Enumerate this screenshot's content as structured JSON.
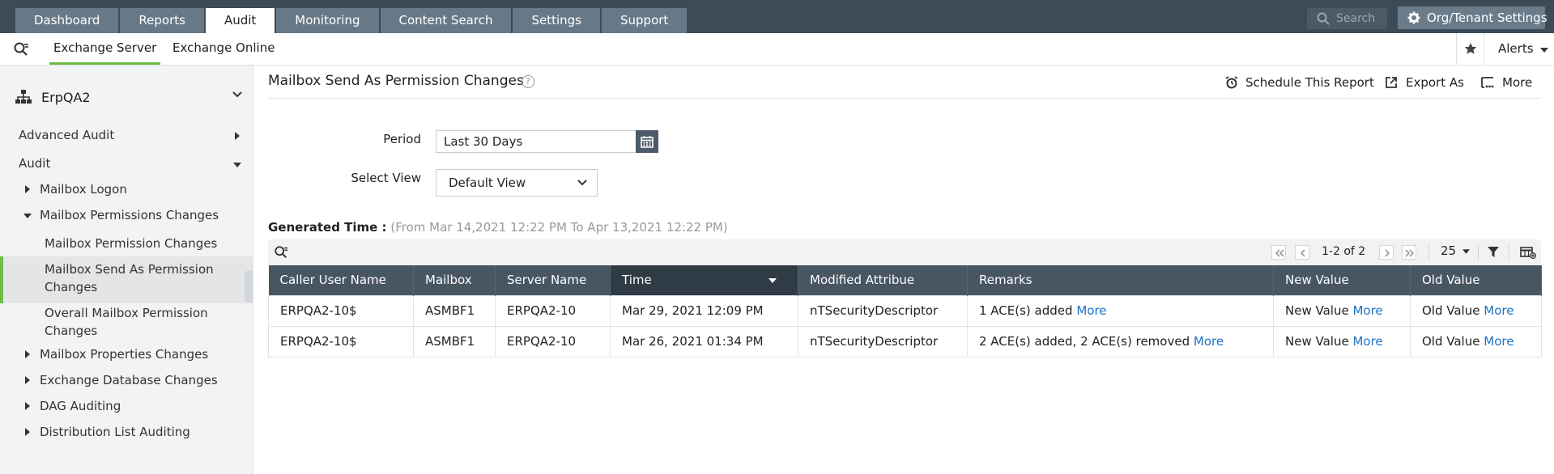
{
  "top_tabs": [
    "Dashboard",
    "Reports",
    "Audit",
    "Monitoring",
    "Content Search",
    "Settings",
    "Support"
  ],
  "active_tab": "Audit",
  "search_placeholder": "Search",
  "org_button": "Org/Tenant Settings",
  "sub_tabs": [
    "Exchange Server",
    "Exchange Online"
  ],
  "alerts_label": "Alerts",
  "sidebar": {
    "org_name": "ErpQA2",
    "advanced_audit": "Advanced Audit",
    "audit": "Audit",
    "items": [
      "Mailbox Logon",
      "Mailbox Permissions Changes",
      "Mailbox Permission Changes",
      "Mailbox Send As Permission",
      "Changes",
      "Overall Mailbox Permission",
      "Changes",
      "Mailbox Properties Changes",
      "Exchange Database Changes",
      "DAG Auditing",
      "Distribution List Auditing"
    ]
  },
  "page": {
    "title": "Mailbox Send As Permission Changes",
    "help": "?",
    "actions": [
      "Schedule This Report",
      "Export As",
      "More"
    ]
  },
  "form": {
    "period_label": "Period",
    "period_value": "Last 30 Days",
    "view_label": "Select View",
    "view_value": "Default View"
  },
  "generated": {
    "label": "Generated Time :",
    "value": "(From Mar 14,2021 12:22 PM To Apr 13,2021 12:22 PM)"
  },
  "pager": {
    "text": "1-2 of 2",
    "per_page": "25"
  },
  "table": {
    "columns": [
      "Caller User Name",
      "Mailbox",
      "Server Name",
      "Time",
      "Modified Attribue",
      "Remarks",
      "New Value",
      "Old Value"
    ],
    "sorted_column": "Time",
    "link_label": "More",
    "rows": [
      {
        "caller": "ERPQA2-10$",
        "mailbox": "ASMBF1",
        "server": "ERPQA2-10",
        "time": "Mar 29, 2021 12:09 PM",
        "attribute": "nTSecurityDescriptor",
        "remarks": "1 ACE(s) added",
        "new_value": "New Value",
        "old_value": "Old Value"
      },
      {
        "caller": "ERPQA2-10$",
        "mailbox": "ASMBF1",
        "server": "ERPQA2-10",
        "time": "Mar 26, 2021 01:34 PM",
        "attribute": "nTSecurityDescriptor",
        "remarks": "2 ACE(s) added, 2 ACE(s) removed",
        "new_value": "New Value",
        "old_value": "Old Value"
      }
    ]
  },
  "colors": {
    "topbar": "#3d4b57",
    "accent": "#6cbd45",
    "link": "#1a73c6",
    "table_header": "#485662"
  }
}
